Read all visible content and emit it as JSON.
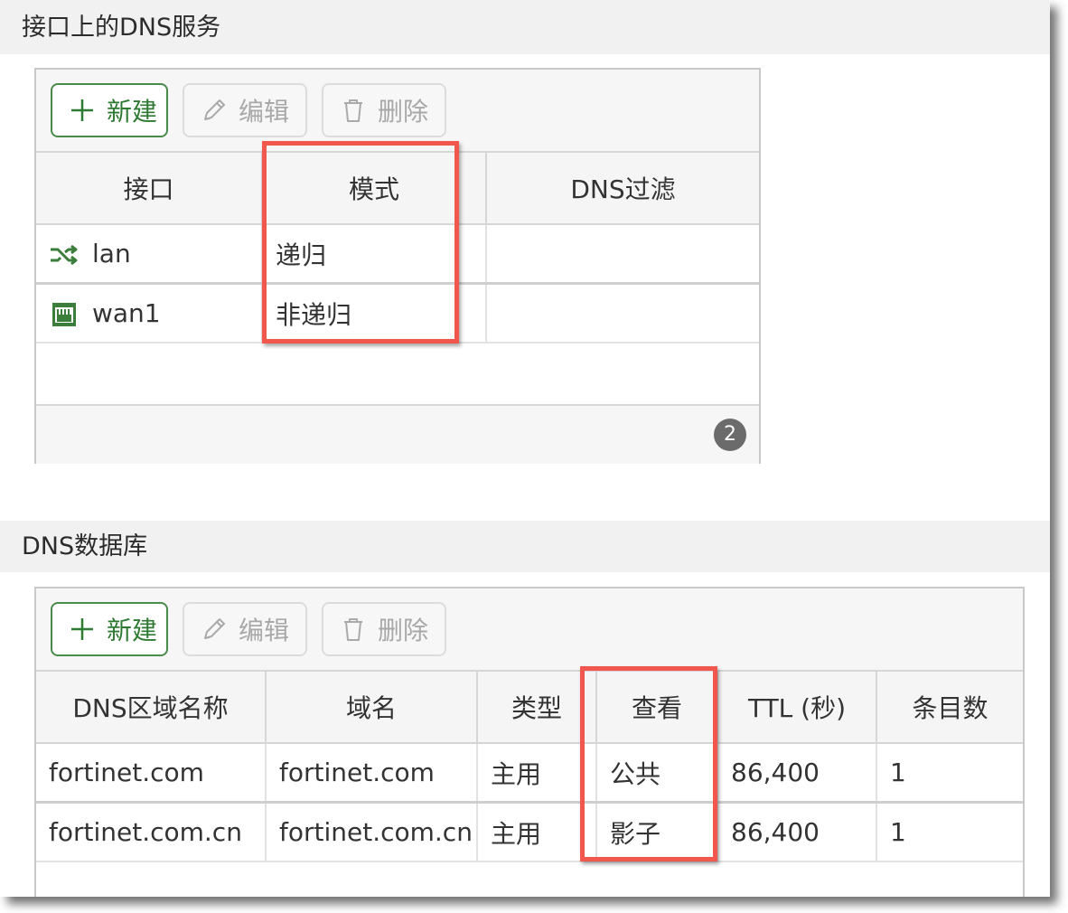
{
  "section1": {
    "title": "接口上的DNS服务",
    "toolbar": {
      "new_label": "新建",
      "edit_label": "编辑",
      "delete_label": "删除"
    },
    "columns": [
      "接口",
      "模式",
      "DNS过滤"
    ],
    "rows": [
      {
        "interface": "lan",
        "mode": "递归",
        "dns_filter": ""
      },
      {
        "interface": "wan1",
        "mode": "非递归",
        "dns_filter": ""
      }
    ],
    "count": "2"
  },
  "section2": {
    "title": "DNS数据库",
    "toolbar": {
      "new_label": "新建",
      "edit_label": "编辑",
      "delete_label": "删除"
    },
    "columns": [
      "DNS区域名称",
      "域名",
      "类型",
      "查看",
      "TTL (秒)",
      "条目数"
    ],
    "rows": [
      {
        "zone": "fortinet.com",
        "domain": "fortinet.com",
        "type": "主用",
        "view": "公共",
        "ttl": "86,400",
        "entries": "1"
      },
      {
        "zone": "fortinet.com.cn",
        "domain": "fortinet.com.cn",
        "type": "主用",
        "view": "影子",
        "ttl": "86,400",
        "entries": "1"
      }
    ]
  },
  "colors": {
    "accent_green": "#2f7a32",
    "highlight_red": "#f2574d"
  }
}
